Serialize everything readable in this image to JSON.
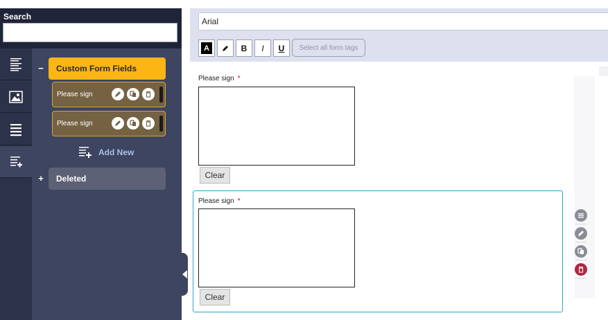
{
  "search": {
    "label": "Search",
    "value": ""
  },
  "sidebar": {
    "custom_group": {
      "toggle": "−",
      "label": "Custom Form Fields"
    },
    "fields": [
      {
        "label": "Please sign"
      },
      {
        "label": "Please sign"
      }
    ],
    "add_new": "Add New",
    "deleted_group": {
      "toggle": "+",
      "label": "Deleted"
    },
    "rail_icons": [
      "list-lines-icon",
      "image-icon",
      "text-align-icon",
      "add-field-icon"
    ]
  },
  "toolbar": {
    "font": "Arial",
    "color_btn": "A",
    "bold": "B",
    "italic": "I",
    "underline": "U",
    "select_all": "Select all form tags"
  },
  "form": {
    "fields": [
      {
        "label": "Please sign",
        "required": "*",
        "clear": "Clear"
      },
      {
        "label": "Please sign",
        "required": "*",
        "clear": "Clear"
      }
    ]
  },
  "colors": {
    "sidebar_bg": "#3d4560",
    "accent_yellow": "#fbb515",
    "selected_border": "#2ba6c8",
    "delete_red": "#b02840"
  }
}
